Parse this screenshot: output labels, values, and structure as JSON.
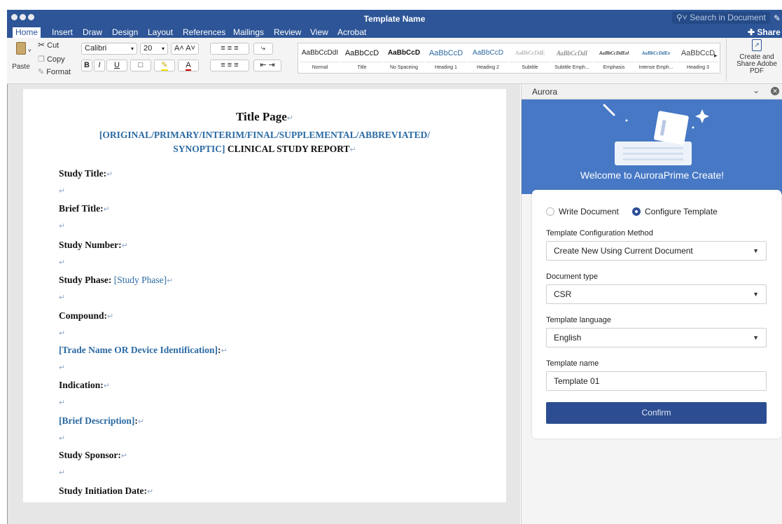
{
  "window": {
    "title": "Template Name",
    "search_placeholder": "Search in Document",
    "share_label": "Share"
  },
  "tabs": [
    "Home",
    "Insert",
    "Draw",
    "Design",
    "Layout",
    "References",
    "Mailings",
    "Review",
    "View",
    "Acrobat"
  ],
  "ribbon": {
    "paste": "Paste",
    "cut": "Cut",
    "copy": "Copy",
    "format": "Format",
    "font_name": "Calibri",
    "font_size": "20",
    "grow_font": "A˄",
    "shrink_font": "A˅",
    "bold": "B",
    "italic": "I",
    "underline": "U",
    "styles": [
      {
        "sample": "AaBbCcDdI",
        "label": "Normal"
      },
      {
        "sample": "AaBbCcD",
        "label": "Title"
      },
      {
        "sample": "AaBbCcD",
        "label": "No Spaceing"
      },
      {
        "sample": "AaBbCcD",
        "label": "Heading 1"
      },
      {
        "sample": "AaBbCcD",
        "label": "Heading 2"
      },
      {
        "sample": "AaBbCcDdE",
        "label": "Subtitle"
      },
      {
        "sample": "AaBbCcDdI",
        "label": "Subtitle Emph..."
      },
      {
        "sample": "AaBbCcDdEel",
        "label": "Emphasis"
      },
      {
        "sample": "AaBbCcDdEe",
        "label": "Intense Emph..."
      },
      {
        "sample": "AaBbCcD",
        "label": "Heading 3"
      }
    ],
    "create_pdf": "Create and Share Adobe PDF"
  },
  "document": {
    "title": "Title Page",
    "subtitle_line1": "[ORIGINAL/PRIMARY/INTERIM/FINAL/SUPPLEMENTAL/ABBREVIATED/",
    "subtitle_line2_blue": "SYNOPTIC]",
    "subtitle_line2_black": " CLINICAL STUDY REPORT",
    "fields": {
      "study_title": "Study Title:",
      "brief_title": "Brief Title:",
      "study_number": "Study Number:",
      "study_phase_label": "Study Phase:",
      "study_phase_value": " [Study Phase]",
      "compound": "Compound:",
      "trade_name": "[Trade Name OR Device Identification]",
      "trade_name_colon": ":",
      "indication": "Indication:",
      "brief_description": "[Brief Description]",
      "brief_description_colon": ":",
      "study_sponsor": "Study Sponsor:",
      "study_initiation_date": "Study Initiation Date:"
    },
    "paragraph_mark": "↵"
  },
  "panel": {
    "name": "Aurora",
    "welcome": "Welcome to AuroraPrime Create!",
    "mode_write": "Write Document",
    "mode_configure": "Configure Template",
    "selected_mode": "Configure Template",
    "config_method_label": "Template Configuration Method",
    "config_method_value": "Create New Using Current Document",
    "doc_type_label": "Document type",
    "doc_type_value": "CSR",
    "language_label": "Template language",
    "language_value": "English",
    "template_name_label": "Template name",
    "template_name_value": "Template 01",
    "confirm": "Confirm"
  },
  "colors": {
    "brand_blue": "#2d5597",
    "confirm_blue": "#2c4d91",
    "doc_link_blue": "#2b6aa3",
    "banner_blue": "#4678c5"
  }
}
